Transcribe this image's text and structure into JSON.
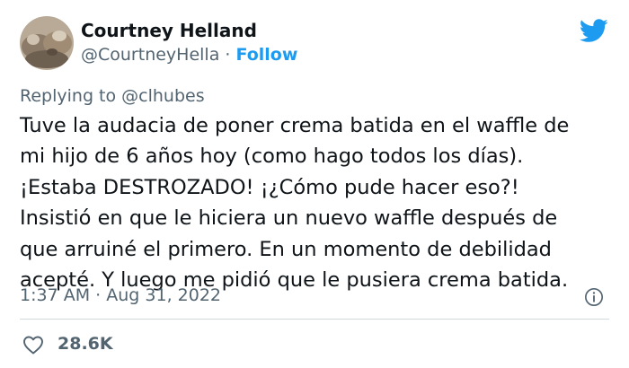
{
  "author": {
    "name": "Courtney Helland",
    "handle": "@CourtneyHella",
    "separator": "·",
    "follow_label": "Follow"
  },
  "reply": {
    "prefix": "Replying to ",
    "handle": "@clhubes"
  },
  "tweet": {
    "lines": [
      "Tuve la audacia de poner crema batida en el waffle de",
      "mi hijo de 6 años hoy (como hago todos los días).",
      "¡Estaba DESTROZADO! ¡¿Cómo pude hacer eso?!",
      "Insistió en que le hiciera un nuevo waffle después de",
      "que arruiné el primero. En un momento de debilidad",
      "acepté. Y luego me pidió que le pusiera crema batida."
    ]
  },
  "meta": {
    "time": "1:37 AM",
    "separator": "·",
    "date": "Aug 31, 2022"
  },
  "engagement": {
    "likes": "28.6K"
  },
  "icons": {
    "brand": "twitter-bird-icon",
    "info": "info-icon",
    "like": "heart-icon"
  },
  "colors": {
    "accent": "#1d9bf0",
    "text": "#0f1419",
    "secondary": "#536471",
    "divider": "#cfd9de"
  }
}
